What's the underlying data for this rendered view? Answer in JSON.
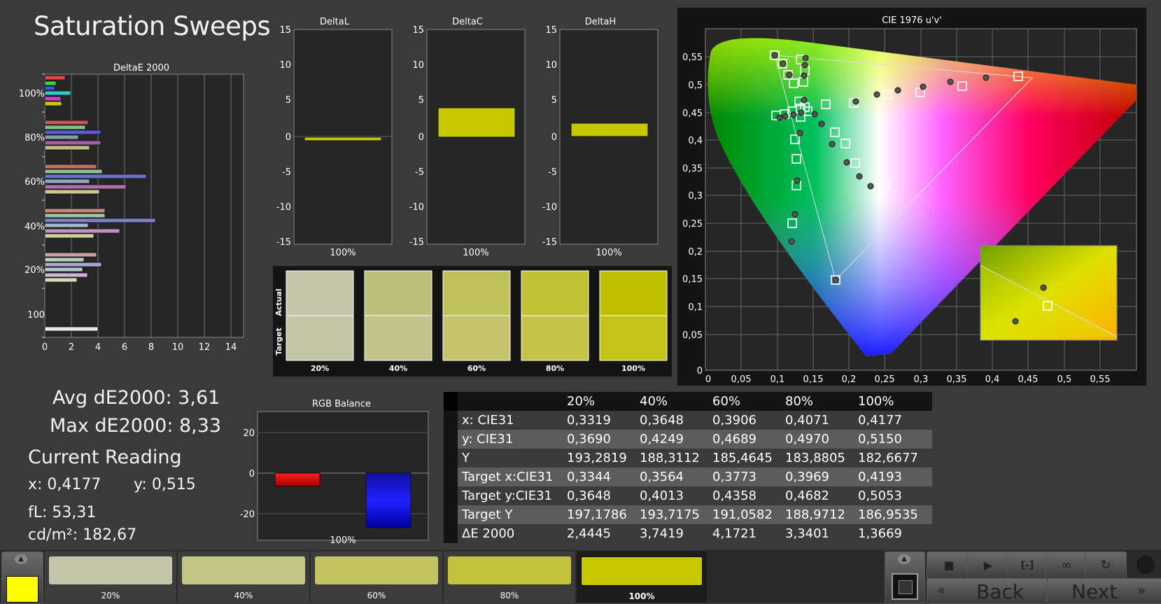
{
  "title": "Saturation Sweeps",
  "colors": {
    "accent": "#c8c800",
    "bg": "#3a3a3a",
    "panel": "#2a2a2a"
  },
  "deltae_chart": {
    "title": "DeltaE 2000",
    "row_labels": [
      "100%",
      "80%",
      "60%",
      "40%",
      "20%",
      "100"
    ],
    "x_ticks": [
      "0",
      "2",
      "4",
      "6",
      "8",
      "10",
      "12",
      "14"
    ]
  },
  "delta_charts": [
    {
      "title": "DeltaL",
      "ticks": [
        "15",
        "10",
        "5",
        "0",
        "-5",
        "-10",
        "-15"
      ],
      "label": "100%"
    },
    {
      "title": "DeltaC",
      "ticks": [
        "15",
        "10",
        "5",
        "0",
        "-5",
        "-10",
        "-15"
      ],
      "label": "100%"
    },
    {
      "title": "DeltaH",
      "ticks": [
        "15",
        "10",
        "5",
        "0",
        "-5",
        "-10",
        "-15"
      ],
      "label": "100%"
    }
  ],
  "swatches": {
    "actual_label": "Actual",
    "target_label": "Target",
    "labels": [
      "20%",
      "40%",
      "60%",
      "80%",
      "100%"
    ]
  },
  "cie": {
    "title": "CIE 1976 u'v'",
    "y_ticks": [
      "0,55",
      "0,5",
      "0,45",
      "0,4",
      "0,35",
      "0,3",
      "0,25",
      "0,2",
      "0,15",
      "0,1",
      "0,05",
      "0"
    ],
    "x_ticks": [
      "0",
      "0,05",
      "0,1",
      "0,15",
      "0,2",
      "0,25",
      "0,3",
      "0,35",
      "0,4",
      "0,45",
      "0,5",
      "0,55"
    ]
  },
  "stats": {
    "avg": "Avg dE2000: 3,61",
    "max": "Max dE2000: 8,33",
    "current": "Current Reading",
    "x": "x: 0,4177",
    "y": "y: 0,515",
    "fl": "fL: 53,31",
    "cd": "cd/m²: 182,67"
  },
  "rgb_balance": {
    "title": "RGB Balance",
    "ticks": [
      "20",
      "0",
      "-20"
    ],
    "label": "100%"
  },
  "table": {
    "headers": [
      "",
      "20%",
      "40%",
      "60%",
      "80%",
      "100%"
    ],
    "rows": [
      [
        "x: CIE31",
        "0,3319",
        "0,3648",
        "0,3906",
        "0,4071",
        "0,4177"
      ],
      [
        "y: CIE31",
        "0,3690",
        "0,4249",
        "0,4689",
        "0,4970",
        "0,5150"
      ],
      [
        "Y",
        "193,2819",
        "188,3112",
        "185,4645",
        "183,8805",
        "182,6677"
      ],
      [
        "Target x:CIE31",
        "0,3344",
        "0,3564",
        "0,3773",
        "0,3969",
        "0,4193"
      ],
      [
        "Target y:CIE31",
        "0,3648",
        "0,4013",
        "0,4358",
        "0,4682",
        "0,5053"
      ],
      [
        "Target Y",
        "197,1786",
        "193,7175",
        "191,0582",
        "188,9712",
        "186,9535"
      ],
      [
        "ΔE 2000",
        "2,4445",
        "3,7419",
        "4,1721",
        "3,3401",
        "1,3669"
      ]
    ]
  },
  "bottom_bar": {
    "swatch_labels": [
      "20%",
      "40%",
      "60%",
      "80%",
      "100%"
    ],
    "back": "Back",
    "next": "Next"
  }
}
